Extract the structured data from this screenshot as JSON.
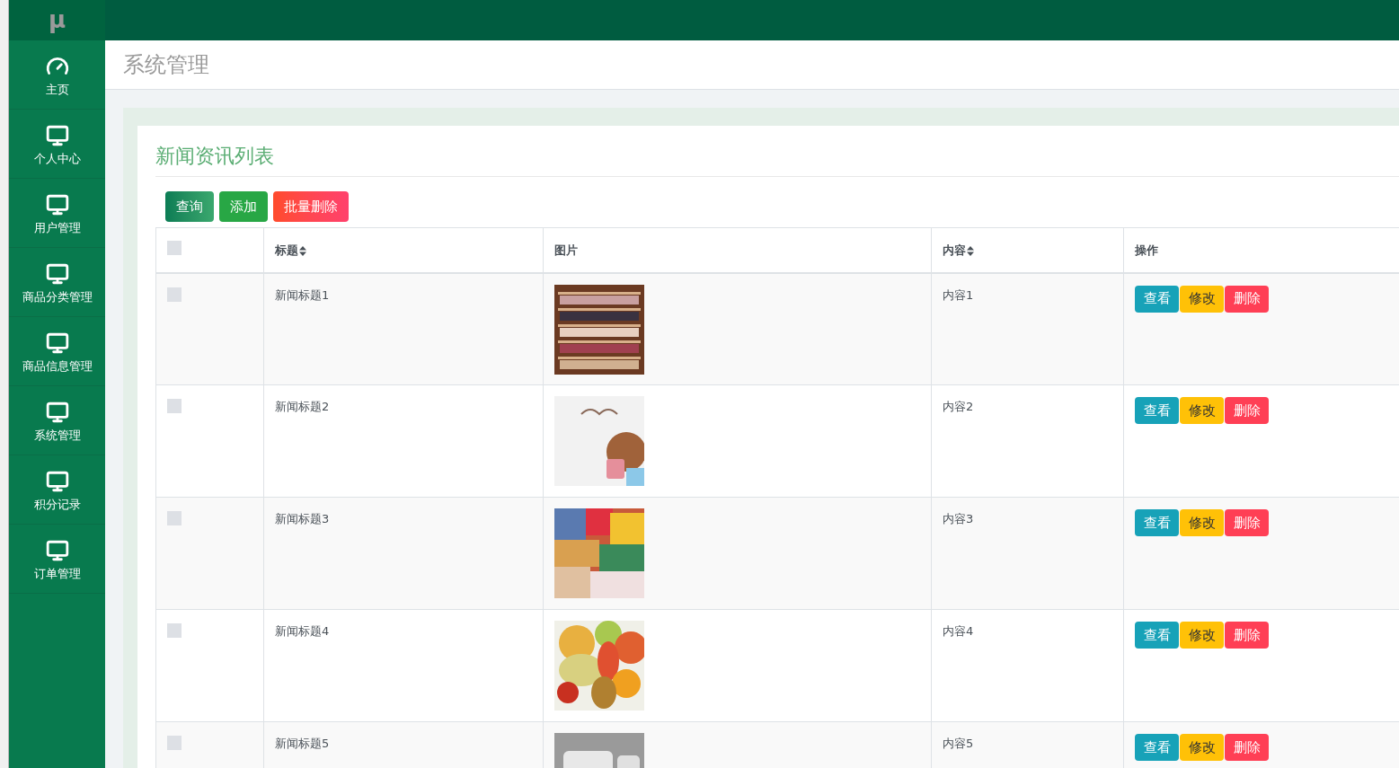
{
  "logo": "μ",
  "sidebar": {
    "items": [
      {
        "label": "主页",
        "kind": "dashboard"
      },
      {
        "label": "个人中心",
        "kind": "module"
      },
      {
        "label": "用户管理",
        "kind": "module"
      },
      {
        "label": "商品分类管理",
        "kind": "module"
      },
      {
        "label": "商品信息管理",
        "kind": "module"
      },
      {
        "label": "系统管理",
        "kind": "module"
      },
      {
        "label": "积分记录",
        "kind": "module"
      },
      {
        "label": "订单管理",
        "kind": "module"
      }
    ]
  },
  "page_title": "系统管理",
  "card": {
    "title": "新闻资讯列表",
    "toolbar": [
      {
        "label": "查询",
        "kind": "search"
      },
      {
        "label": "添加",
        "kind": "add"
      },
      {
        "label": "批量删除",
        "kind": "delete"
      }
    ],
    "table": {
      "select_all": {
        "checked": false
      },
      "columns": [
        {
          "label": "标题",
          "sortable": true
        },
        {
          "label": "图片",
          "sortable": false
        },
        {
          "label": "内容",
          "sortable": true
        },
        {
          "label": "操作",
          "sortable": false
        }
      ],
      "rows": [
        {
          "checked": false,
          "title": "新闻标题1",
          "image": {
            "kind": "picture"
          },
          "content": "内容1",
          "actions": [
            {
              "label": "查看",
              "kind": "view"
            },
            {
              "label": "修改",
              "kind": "edit"
            },
            {
              "label": "删除",
              "kind": "delete"
            }
          ]
        },
        {
          "checked": false,
          "title": "新闻标题2",
          "image": {
            "kind": "picture"
          },
          "content": "内容2",
          "actions": [
            {
              "label": "查看",
              "kind": "view"
            },
            {
              "label": "修改",
              "kind": "edit"
            },
            {
              "label": "删除",
              "kind": "delete"
            }
          ]
        },
        {
          "checked": false,
          "title": "新闻标题3",
          "image": {
            "kind": "picture"
          },
          "content": "内容3",
          "actions": [
            {
              "label": "查看",
              "kind": "view"
            },
            {
              "label": "修改",
              "kind": "edit"
            },
            {
              "label": "删除",
              "kind": "delete"
            }
          ]
        },
        {
          "checked": false,
          "title": "新闻标题4",
          "image": {
            "kind": "picture"
          },
          "content": "内容4",
          "actions": [
            {
              "label": "查看",
              "kind": "view"
            },
            {
              "label": "修改",
              "kind": "edit"
            },
            {
              "label": "删除",
              "kind": "delete"
            }
          ]
        },
        {
          "checked": false,
          "title": "新闻标题5",
          "image": {
            "kind": "picture"
          },
          "content": "内容5",
          "actions": [
            {
              "label": "查看",
              "kind": "view"
            },
            {
              "label": "修改",
              "kind": "edit"
            },
            {
              "label": "删除",
              "kind": "delete"
            }
          ]
        }
      ]
    }
  }
}
